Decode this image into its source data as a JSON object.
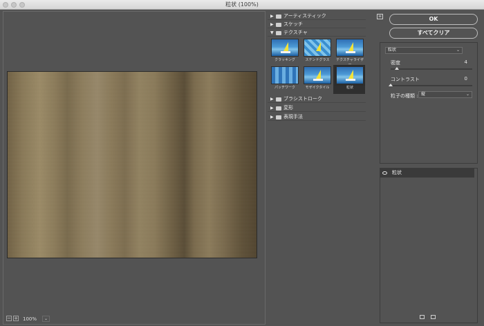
{
  "window": {
    "title": "粒状 (100%)"
  },
  "preview": {
    "zoom": "100%",
    "zoom_out_label": "−",
    "zoom_in_label": "+",
    "zoom_dropdown": "⌄"
  },
  "gallery": {
    "categories_top": [
      {
        "label": "アーティスティック",
        "arrow": "▶"
      },
      {
        "label": "スケッチ",
        "arrow": "▶"
      },
      {
        "label": "テクスチャ",
        "arrow": "▼"
      }
    ],
    "thumbnails": [
      {
        "label": "クラッキング"
      },
      {
        "label": "ステンドグラス"
      },
      {
        "label": "テクスチャライザー"
      },
      {
        "label": "パッチワーク"
      },
      {
        "label": "モザイクタイル"
      },
      {
        "label": "粒状"
      }
    ],
    "categories_bottom": [
      {
        "label": "ブラシストローク",
        "arrow": "▶"
      },
      {
        "label": "変形",
        "arrow": "▶"
      },
      {
        "label": "表現手法",
        "arrow": "▶"
      }
    ]
  },
  "settings": {
    "help": "≡",
    "ok_label": "OK",
    "clear_all_label": "すべてクリア",
    "filter_select": "粒状",
    "intensity": {
      "label": "密度",
      "value": "4",
      "level_percent": 4
    },
    "contrast": {
      "label": "コントラスト",
      "value": "0",
      "level_percent": 0
    },
    "grain_type": {
      "label": "粒子の種類 :",
      "value": "縦"
    }
  },
  "layers": {
    "items": [
      {
        "name": "粒状"
      }
    ]
  },
  "colors": {
    "background": "#535353",
    "panel_dark": "#3a3a3a",
    "texture_mid": "#8a7a58"
  }
}
